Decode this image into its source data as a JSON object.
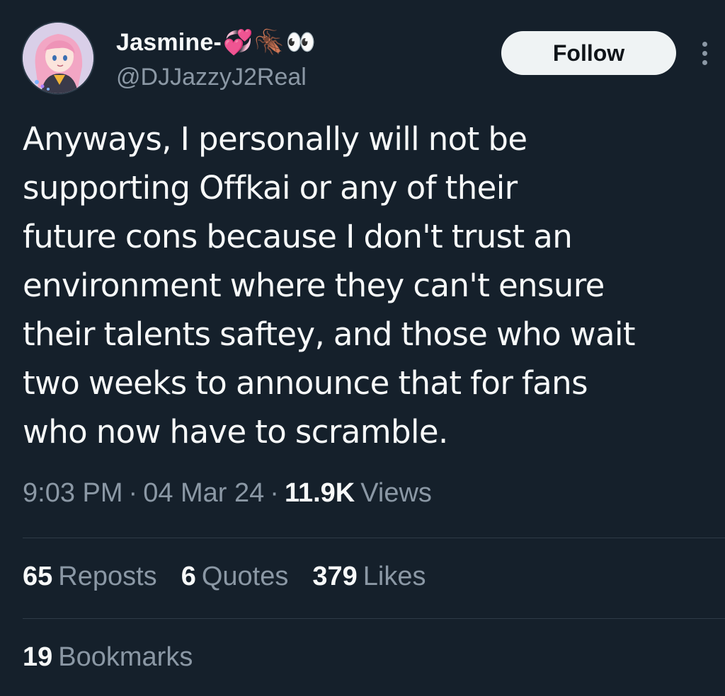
{
  "author": {
    "display_name": "Jasmine-",
    "name_emojis": [
      "💞",
      "🪳",
      "👀"
    ],
    "handle": "@DJJazzyJ2Real",
    "avatar_icon": "anime-avatar"
  },
  "actions": {
    "follow_label": "Follow",
    "more_icon": "more-vertical-icon"
  },
  "tweet": {
    "lines": [
      "Anyways, I personally will not be",
      "supporting Offkai or any of their",
      "future cons because I don't trust an",
      "environment where they can't ensure",
      "their talents saftey, and those who wait",
      "two weeks to announce that for fans",
      "who now have to scramble."
    ]
  },
  "meta": {
    "time": "9:03 PM",
    "date": "04 Mar 24",
    "views_count": "11.9K",
    "views_label": "Views",
    "separator": "·"
  },
  "stats": {
    "reposts_count": "65",
    "reposts_label": "Reposts",
    "quotes_count": "6",
    "quotes_label": "Quotes",
    "likes_count": "379",
    "likes_label": "Likes",
    "bookmarks_count": "19",
    "bookmarks_label": "Bookmarks"
  },
  "colors": {
    "background": "#15202b",
    "text_primary": "#f7f9f9",
    "text_secondary": "#8b98a5",
    "divider": "#2f3b47",
    "follow_bg": "#eff3f4"
  }
}
